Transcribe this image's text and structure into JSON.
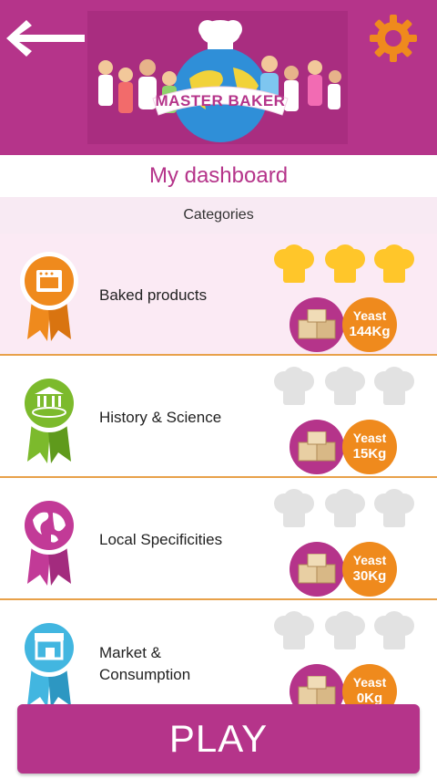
{
  "header": {
    "logo": {
      "text": "MASTER BAKER"
    }
  },
  "dashboard": {
    "title": "My dashboard"
  },
  "categories_header": "Categories",
  "categories": [
    {
      "label": "Baked products",
      "hats": [
        "gold",
        "gold",
        "gold"
      ],
      "yeast_label": "Yeast",
      "yeast_value": "144Kg",
      "badge_color": "#ef8a1d",
      "badge_icon": "oven-icon"
    },
    {
      "label": "History & Science",
      "hats": [
        "grey",
        "grey",
        "grey"
      ],
      "yeast_label": "Yeast",
      "yeast_value": "15Kg",
      "badge_color": "#7cba2c",
      "badge_icon": "museum-icon"
    },
    {
      "label": "Local Specificities",
      "hats": [
        "grey",
        "grey",
        "grey"
      ],
      "yeast_label": "Yeast",
      "yeast_value": "30Kg",
      "badge_color": "#c23a97",
      "badge_icon": "globe-icon"
    },
    {
      "label_line1": "Market &",
      "label_line2": "Consumption",
      "hats": [
        "grey",
        "grey",
        "grey"
      ],
      "yeast_label": "Yeast",
      "yeast_value": "0Kg",
      "badge_color": "#42b6e0",
      "badge_icon": "shop-icon"
    }
  ],
  "play_button": "PLAY",
  "colors": {
    "brand": "#b5348a",
    "accent": "#ef8a1d",
    "hat_gold": "#ffc62a",
    "hat_grey": "#e2e2e2",
    "row_divider": "#e8a14a"
  }
}
